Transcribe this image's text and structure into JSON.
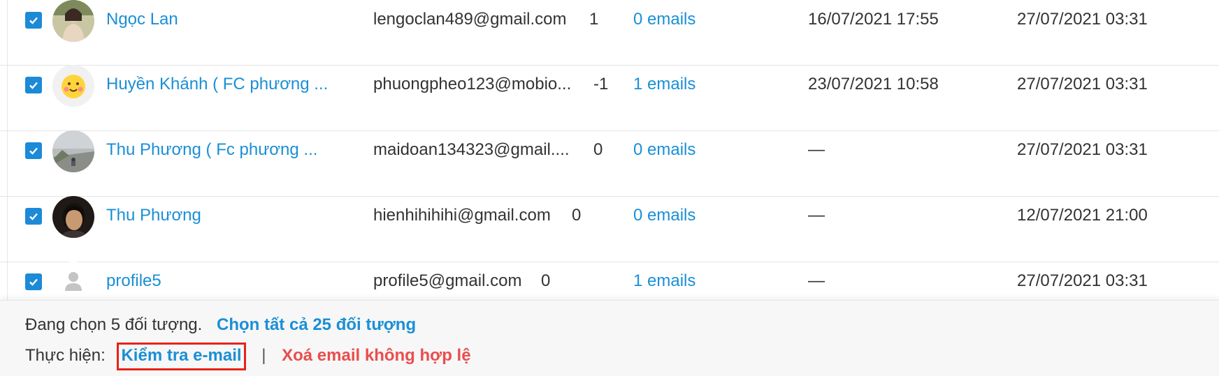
{
  "rows": [
    {
      "name": "Ngọc Lan",
      "email": "lengoclan489@gmail.com",
      "count": "1",
      "emails": "0 emails",
      "date1": "16/07/2021 17:55",
      "date2": "27/07/2021 03:31",
      "avatar": "photo-avatar"
    },
    {
      "name": "Huyền Khánh ( FC phương ...",
      "email": "phuongpheo123@mobio...",
      "count": "-1",
      "emails": "1 emails",
      "date1": "23/07/2021 10:58",
      "date2": "27/07/2021 03:31",
      "avatar": "smiley-avatar"
    },
    {
      "name": "Thu Phương ( Fc phương ...",
      "email": "maidoan134323@gmail....",
      "count": "0",
      "emails": "0 emails",
      "date1": "—",
      "date2": "27/07/2021 03:31",
      "avatar": "photo-avatar"
    },
    {
      "name": "Thu Phương",
      "email": "hienhihihihi@gmail.com",
      "count": "0",
      "emails": "0 emails",
      "date1": "—",
      "date2": "12/07/2021 21:00",
      "avatar": "photo-avatar"
    },
    {
      "name": "profile5",
      "email": "profile5@gmail.com",
      "count": "0",
      "emails": "1 emails",
      "date1": "—",
      "date2": "27/07/2021 03:31",
      "avatar": "default-user-icon"
    }
  ],
  "footer": {
    "selected_text": "Đang chọn 5 đối tượng.",
    "select_all_link": "Chọn tất cả 25 đối tượng",
    "action_label": "Thực hiện:",
    "check_email_link": "Kiểm tra e-mail",
    "separator": "|",
    "delete_invalid_link": "Xoá email không hợp lệ"
  },
  "colors": {
    "link": "#1a8fd6",
    "danger": "#ea4d4d",
    "checkbox": "#1c8ad6",
    "highlight": "#e8221a"
  }
}
